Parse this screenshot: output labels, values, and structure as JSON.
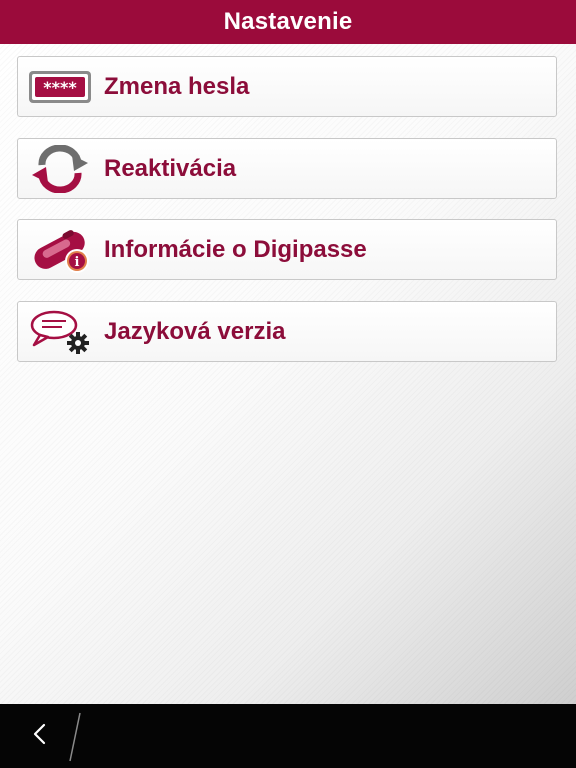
{
  "header": {
    "title": "Nastavenie"
  },
  "menu": {
    "items": [
      {
        "label": "Zmena hesla",
        "icon": "password-field-icon"
      },
      {
        "label": "Reaktivácia",
        "icon": "refresh-arrows-icon"
      },
      {
        "label": "Informácie o Digipasse",
        "icon": "digipass-info-icon"
      },
      {
        "label": "Jazyková verzia",
        "icon": "language-settings-icon"
      }
    ]
  },
  "navigation": {
    "back_icon": "chevron-left-icon"
  },
  "colors": {
    "brand": "#9b0b3b",
    "label": "#8c0d3a",
    "icon_gray": "#6e6e6e",
    "bottom_bar": "#050505"
  }
}
